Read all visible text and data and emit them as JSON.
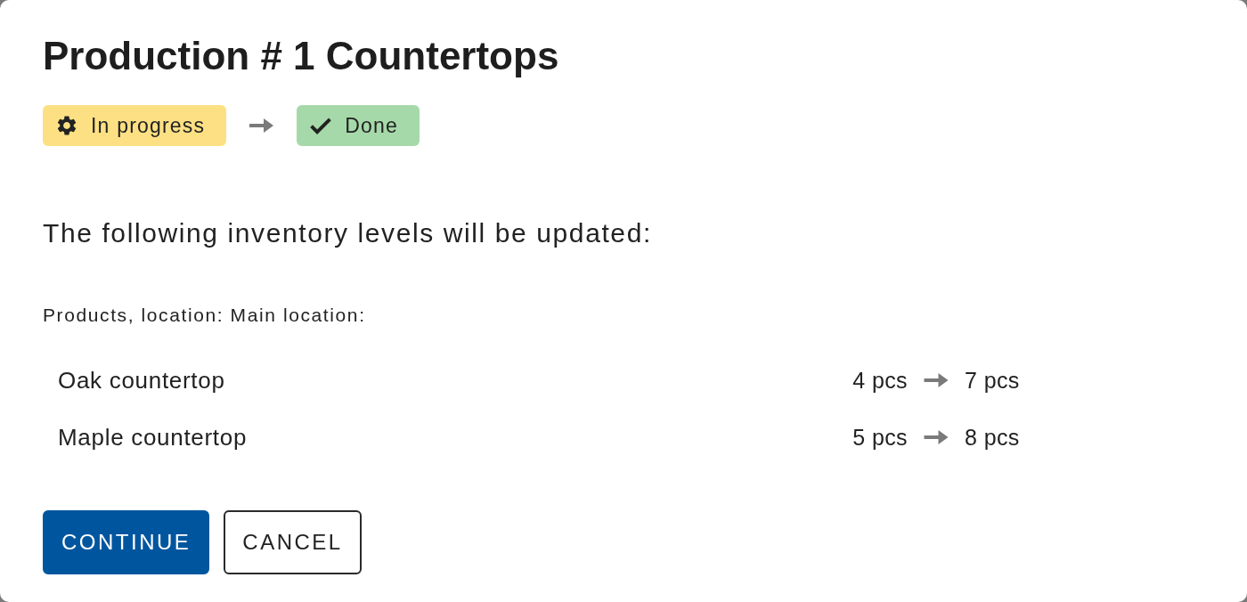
{
  "dialog": {
    "title": "Production # 1 Countertops",
    "status_change": [
      {
        "kind": "in_progress",
        "label": "In progress",
        "color": "#fde083"
      },
      {
        "kind": "done",
        "label": "Done",
        "color": "#a6d9a9"
      }
    ],
    "message": "The following inventory levels will be updated:",
    "section_label": "Products, location: Main location:",
    "items": [
      {
        "name": "Oak countertop",
        "from": "4 pcs",
        "to": "7 pcs"
      },
      {
        "name": "Maple countertop",
        "from": "5 pcs",
        "to": "8 pcs"
      }
    ],
    "buttons": [
      {
        "kind": "primary",
        "label": "CONTINUE"
      },
      {
        "kind": "secondary",
        "label": "CANCEL"
      }
    ]
  }
}
